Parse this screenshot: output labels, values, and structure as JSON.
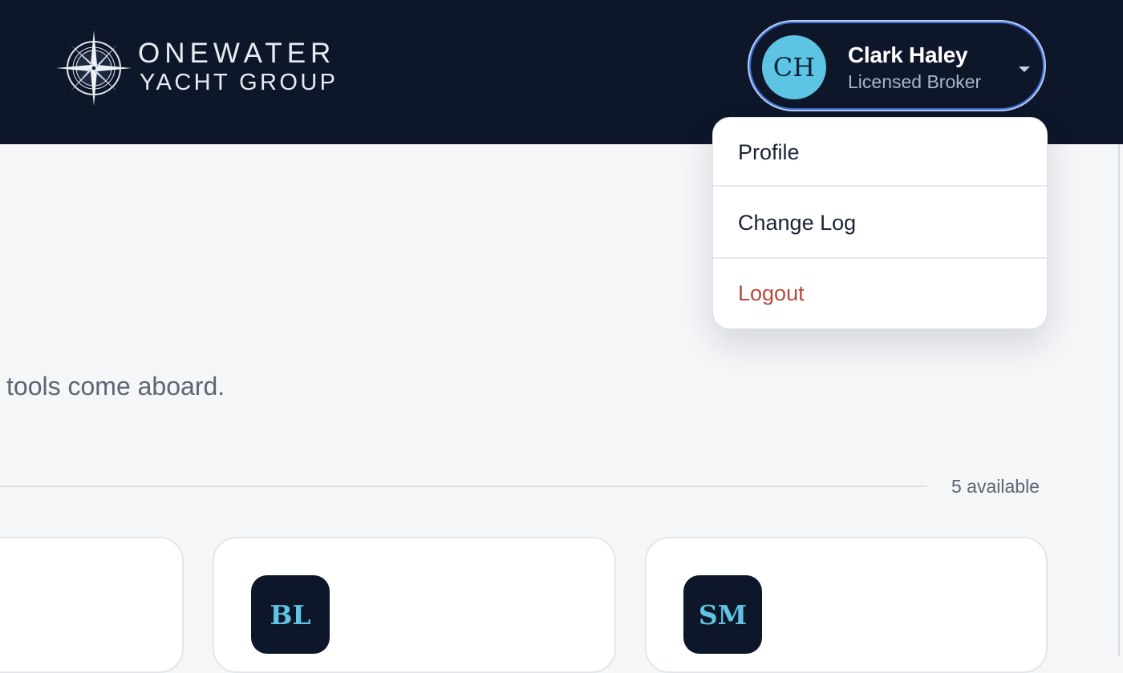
{
  "brand": {
    "line1": "ONEWATER",
    "line2": "YACHT GROUP",
    "logo_icon": "compass-rose-icon"
  },
  "user": {
    "initials": "CH",
    "name": "Clark Haley",
    "role": "Licensed Broker",
    "avatar_color": "#5dc4e3",
    "menu_caret_icon": "caret-down-icon"
  },
  "user_menu": {
    "items": [
      {
        "label": "Profile"
      },
      {
        "label": "Change Log"
      },
      {
        "label": "Logout",
        "color": "#b9493c"
      }
    ]
  },
  "hero": {
    "tagline_partial": "tools come aboard."
  },
  "apps": {
    "count_label": "5 available",
    "cards": [
      {
        "initials": ""
      },
      {
        "initials": "BL"
      },
      {
        "initials": "SM"
      }
    ]
  },
  "colors": {
    "header_bg": "#0e1729",
    "accent": "#5dc4e3",
    "focus_ring": "#3d6fd8",
    "page_bg": "#f4f6f8"
  }
}
